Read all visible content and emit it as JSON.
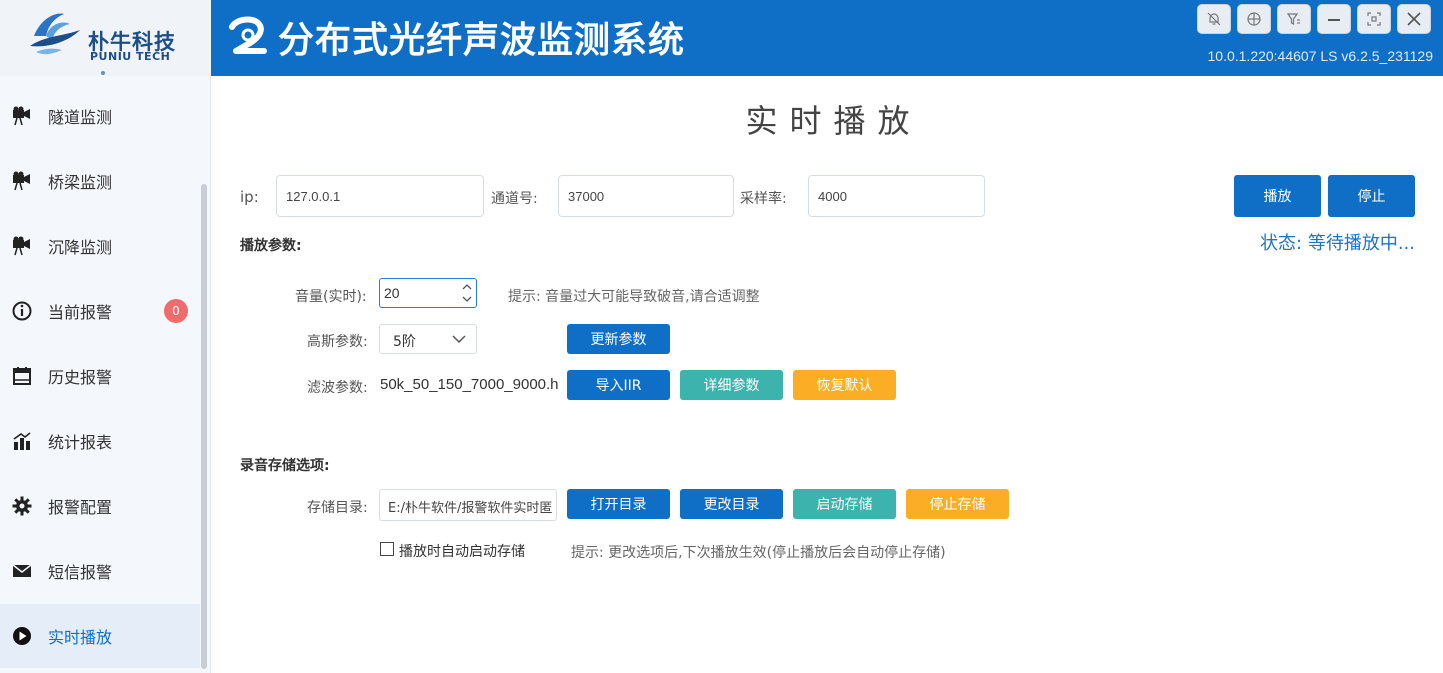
{
  "header": {
    "logo_cn": "朴牛科技",
    "logo_en": "PUNIU TECH",
    "title": "分布式光纤声波监测系统",
    "version": "10.0.1.220:44607 LS v6.2.5_231129",
    "window_buttons": [
      "bell-off-icon",
      "target-icon",
      "filter-icon",
      "minimize-icon",
      "fit-screen-icon",
      "close-icon"
    ]
  },
  "sidebar": {
    "items": [
      {
        "label": "隧道监测",
        "icon": "camera-icon"
      },
      {
        "label": "桥梁监测",
        "icon": "camera-icon"
      },
      {
        "label": "沉降监测",
        "icon": "camera-icon"
      },
      {
        "label": "当前报警",
        "icon": "info-icon",
        "badge": "0"
      },
      {
        "label": "历史报警",
        "icon": "calendar-icon"
      },
      {
        "label": "统计报表",
        "icon": "bar-chart-icon"
      },
      {
        "label": "报警配置",
        "icon": "gear-icon"
      },
      {
        "label": "短信报警",
        "icon": "mail-icon"
      },
      {
        "label": "实时播放",
        "icon": "play-icon",
        "active": true
      }
    ]
  },
  "main": {
    "title": "实时播放",
    "ip_label": "ip:",
    "ip_value": "127.0.0.1",
    "channel_label": "通道号:",
    "channel_value": "37000",
    "rate_label": "采样率:",
    "rate_value": "4000",
    "play_button": "播放",
    "stop_button": "停止",
    "status": "状态: 等待播放中...",
    "playback_section": "播放参数:",
    "volume_label": "音量(实时):",
    "volume_value": "20",
    "volume_hint": "提示: 音量过大可能导致破音,请合适调整",
    "gauss_label": "高斯参数:",
    "gauss_value": "5阶",
    "update_button": "更新参数",
    "filter_label": "滤波参数:",
    "filter_value": "50k_50_150_7000_9000.h",
    "import_button": "导入IIR",
    "detail_button": "详细参数",
    "reset_button": "恢复默认",
    "record_section": "录音存储选项:",
    "dir_label": "存储目录:",
    "dir_value": "E:/朴牛软件/报警软件实时匿",
    "open_dir_button": "打开目录",
    "change_dir_button": "更改目录",
    "start_store_button": "启动存储",
    "stop_store_button": "停止存储",
    "auto_store_label": "播放时自动启动存储",
    "auto_store_checked": false,
    "store_hint": "提示: 更改选项后,下次播放生效(停止播放后会自动停止存储)"
  },
  "colors": {
    "header_blue": "#0f6fc6",
    "teal": "#3cb3ad",
    "amber": "#fbae25",
    "badge_red": "#f06b6b",
    "status_blue": "#1e74c6"
  }
}
